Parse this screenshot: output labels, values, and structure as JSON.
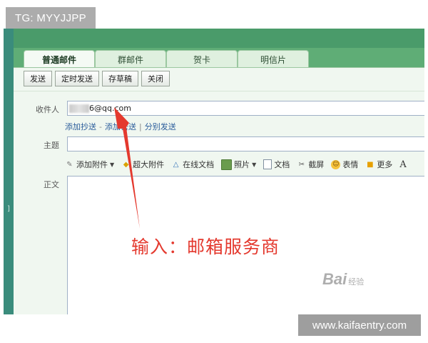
{
  "watermarks": {
    "tg": "TG: MYYJJPP",
    "site": "www.kaifaentry.com",
    "baidu": "Bai",
    "baidu_suffix": "经验"
  },
  "tabs": [
    {
      "label": "普通邮件",
      "active": true
    },
    {
      "label": "群邮件",
      "active": false
    },
    {
      "label": "贺卡",
      "active": false
    },
    {
      "label": "明信片",
      "active": false
    }
  ],
  "toolbar": {
    "send": "发送",
    "scheduled_send": "定时发送",
    "save_draft": "存草稿",
    "close": "关闭"
  },
  "form": {
    "recipient_label": "收件人",
    "recipient_value": "6@qq.com",
    "add_cc": "添加抄送",
    "add_bcc": "添加密送",
    "separate_send": "分别发送",
    "subject_label": "主题",
    "body_label": "正文"
  },
  "format_bar": [
    {
      "label": "添加附件",
      "icon": "paperclip-icon",
      "dropdown": true
    },
    {
      "label": "超大附件",
      "icon": "large-attachment-icon",
      "dropdown": false
    },
    {
      "label": "在线文档",
      "icon": "online-doc-icon",
      "dropdown": false
    },
    {
      "label": "照片",
      "icon": "photo-icon",
      "dropdown": true
    },
    {
      "label": "文档",
      "icon": "document-icon",
      "dropdown": false
    },
    {
      "label": "截屏",
      "icon": "screenshot-icon",
      "dropdown": false
    },
    {
      "label": "表情",
      "icon": "emoji-icon",
      "dropdown": false
    },
    {
      "label": "更多",
      "icon": "more-icon",
      "dropdown": false
    },
    {
      "label": "A",
      "icon": "font-icon",
      "dropdown": false
    }
  ],
  "annotation": "输入：邮箱服务商",
  "colors": {
    "accent_green": "#5fad76",
    "arrow_red": "#e4392e",
    "link_blue": "#2b5d9b"
  }
}
